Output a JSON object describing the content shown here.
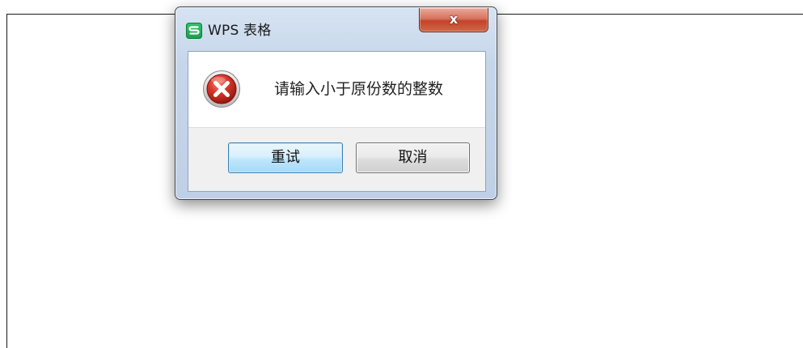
{
  "dialog": {
    "title": "WPS 表格",
    "app_icon": "wps-spreadsheet-icon",
    "close_label": "x",
    "message": "请输入小于原份数的整数",
    "message_icon": "error-icon",
    "buttons": {
      "retry": "重试",
      "cancel": "取消"
    }
  },
  "colors": {
    "app_icon_green": "#1fb35a",
    "close_red": "#c3422b",
    "error_red": "#c92a2a",
    "default_button_border": "#3c7fb1"
  }
}
